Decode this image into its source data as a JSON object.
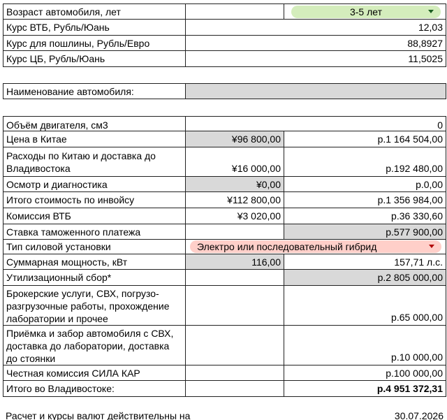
{
  "header_rows": [
    {
      "label": "Возраст автомобиля, лет",
      "dropdown": "3-5 лет"
    },
    {
      "label": "Курс ВТБ, Рубль/Юань",
      "value": "12,03"
    },
    {
      "label": "Курс для пошлины, Рубль/Евро",
      "value": "88,8927"
    },
    {
      "label": "Курс ЦБ, Рубль/Юань",
      "value": "11,5025"
    }
  ],
  "car_name": {
    "label": "Наименование автомобиля:",
    "value": ""
  },
  "rows": {
    "engine": {
      "label": "Объём двигателя, см3",
      "value": "0"
    },
    "price_china": {
      "label": "Цена в Китае",
      "cny": "¥96 800,00",
      "rub": "р.1 164 504,00"
    },
    "china_expenses": {
      "label": "Расходы по Китаю и доставка до Владивостока",
      "cny": "¥16 000,00",
      "rub": "р.192 480,00"
    },
    "inspection": {
      "label": "Осмотр и диагностика",
      "cny": "¥0,00",
      "rub": "р.0,00"
    },
    "invoice_total": {
      "label": "Итого стоимость по инвойсу",
      "cny": "¥112 800,00",
      "rub": "р.1 356 984,00"
    },
    "vtb_fee": {
      "label": "Комиссия ВТБ",
      "cny": "¥3 020,00",
      "rub": "р.36 330,60"
    },
    "customs_rate": {
      "label": "Ставка таможенного платежа",
      "rub": "р.577 900,00"
    },
    "power_type": {
      "label": "Тип силовой установки",
      "dropdown": "Электро или последовательный гибрид"
    },
    "power": {
      "label": "Суммарная мощность, кВт",
      "kw": "116,00",
      "hp": "157,71 л.с."
    },
    "util_fee": {
      "label": "Утилизационный сбор*",
      "rub": "р.2 805 000,00"
    },
    "broker": {
      "label": "Брокерские услуги, СВХ, погрузо-разгрузочные работы, прохождение лаборатории и прочее",
      "rub": "р.65 000,00"
    },
    "pickup": {
      "label": "Приёмка и забор автомобиля с СВХ, доставка до лаборатории, доставка до стоянки",
      "rub": "р.10 000,00"
    },
    "commission": {
      "label": "Честная комиссия СИЛА КАР",
      "rub": "р.100 000,00"
    },
    "total": {
      "label": "Итого во Владивостоке:",
      "rub": "р.4 951 372,31"
    }
  },
  "footer": {
    "label": "Расчет и курсы валют действительны на",
    "date": "30.07.2026"
  },
  "colors": {
    "green_chip": "#d4edbc",
    "green_arrow": "#1b5e20",
    "red_chip": "#ffcfc9",
    "red_arrow": "#b10202",
    "gray_cell": "#d9d9d9"
  }
}
